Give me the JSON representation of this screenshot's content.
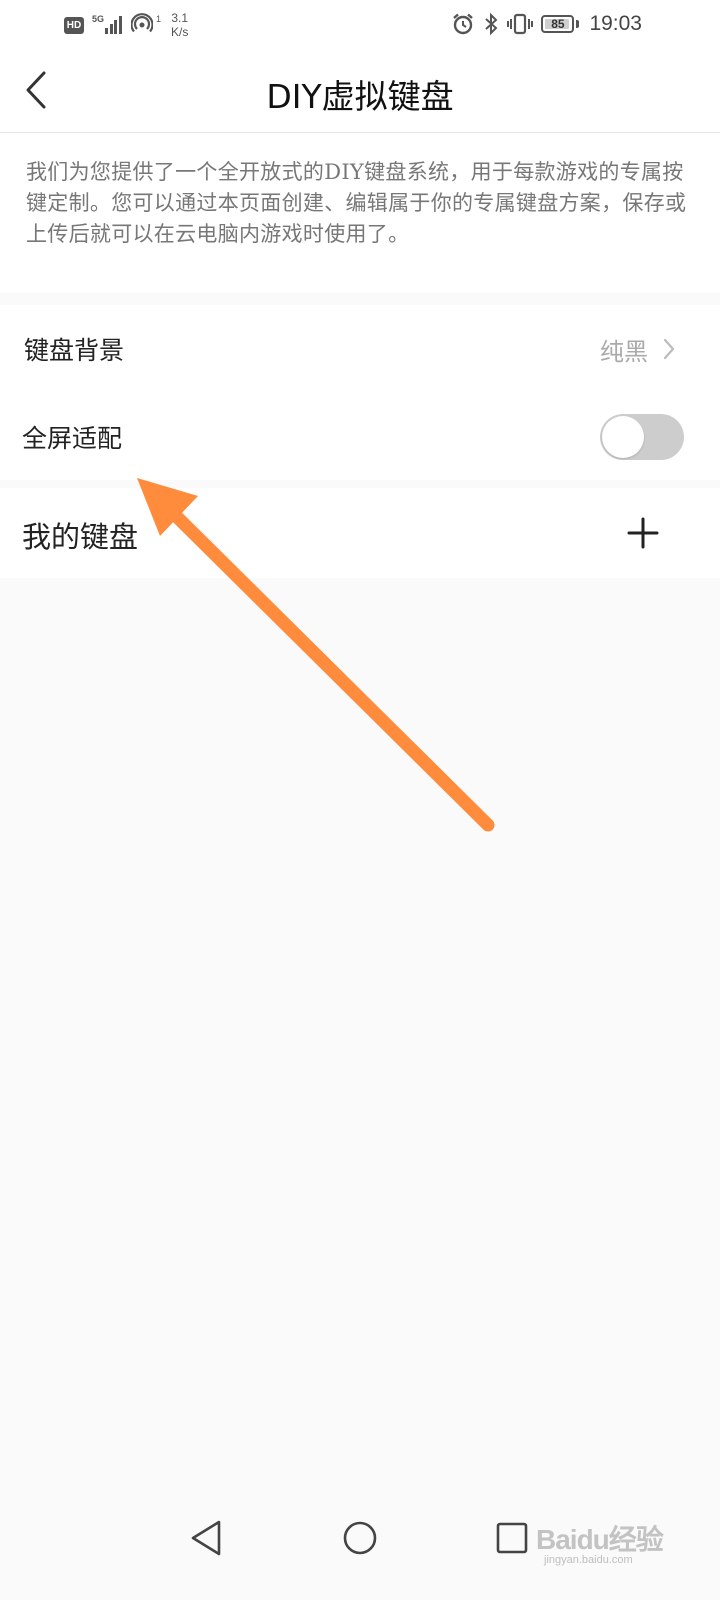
{
  "status_bar": {
    "hd_label": "HD",
    "network_type": "5G",
    "hotspot_count": "1",
    "speed_value": "3.1",
    "speed_unit": "K/s",
    "battery_level": "85",
    "time": "19:03",
    "icons": [
      "alarm-icon",
      "bluetooth-icon",
      "vibrate-icon",
      "battery-icon"
    ]
  },
  "header": {
    "title": "DIY虚拟键盘",
    "back_icon": "chevron-left-icon"
  },
  "description": {
    "text": "我们为您提供了一个全开放式的DIY键盘系统，用于每款游戏的专属按键定制。您可以通过本页面创建、编辑属于你的专属键盘方案，保存或上传后就可以在云电脑内游戏时使用了。"
  },
  "settings": {
    "keyboard_background": {
      "label": "键盘背景",
      "value": "纯黑"
    },
    "fullscreen_fit": {
      "label": "全屏适配",
      "enabled": false
    }
  },
  "my_keyboards": {
    "title": "我的键盘",
    "add_icon": "plus-icon"
  },
  "annotation": {
    "color": "#ff8c3c"
  },
  "nav_bar": {
    "icons": [
      "back-triangle-icon",
      "home-circle-icon",
      "recents-square-icon"
    ]
  },
  "watermark": {
    "logo": "Baidu经验",
    "url": "jingyan.baidu.com"
  }
}
